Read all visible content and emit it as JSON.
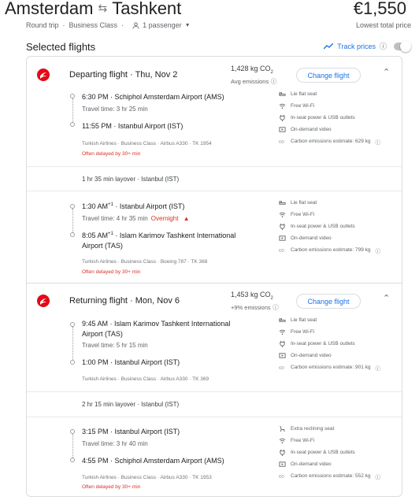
{
  "header": {
    "origin": "Amsterdam",
    "destination": "Tashkent",
    "price": "€1,550",
    "price_note": "Lowest total price",
    "trip_type": "Round trip",
    "cabin": "Business Class",
    "passengers": "1 passenger"
  },
  "selected": {
    "title": "Selected flights",
    "track_prices": "Track prices"
  },
  "departing": {
    "title": "Departing flight · Thu, Nov 2",
    "emissions": "1,428 kg CO",
    "emissions_sub": "2",
    "emissions_note": "Avg emissions",
    "change_label": "Change flight",
    "segments": [
      {
        "dep_time": "6:30 PM",
        "dep_sup": "",
        "dep_airport": "Schiphol Amsterdam Airport (AMS)",
        "travel_time": "Travel time: 3 hr 25 min",
        "overnight": "",
        "arr_time": "11:55 PM",
        "arr_sup": "",
        "arr_airport": "Istanbul Airport (IST)",
        "meta": "Turkish Airlines · Business Class · Airbus A330 · TK 1954",
        "delay": "Often delayed by 30+ min",
        "amenities": [
          "Lie flat seat",
          "Free Wi-Fi",
          "In-seat power & USB outlets",
          "On-demand video",
          "Carbon emissions estimate: 629 kg"
        ]
      },
      {
        "dep_time": "1:30 AM",
        "dep_sup": "+1",
        "dep_airport": "Istanbul Airport (IST)",
        "travel_time": "Travel time: 4 hr 35 min",
        "overnight": "Overnight",
        "arr_time": "8:05 AM",
        "arr_sup": "+1",
        "arr_airport": "Islam Karimov Tashkent International Airport (TAS)",
        "meta": "Turkish Airlines · Business Class · Boeing 787 · TK 368",
        "delay": "Often delayed by 30+ min",
        "amenities": [
          "Lie flat seat",
          "Free Wi-Fi",
          "In-seat power & USB outlets",
          "On-demand video",
          "Carbon emissions estimate: 799 kg"
        ]
      }
    ],
    "layover": "1 hr 35 min layover · Istanbul (IST)"
  },
  "returning": {
    "title": "Returning flight · Mon, Nov 6",
    "emissions": "1,453 kg CO",
    "emissions_sub": "2",
    "emissions_note": "+9% emissions",
    "change_label": "Change flight",
    "segments": [
      {
        "dep_time": "9:45 AM",
        "dep_sup": "",
        "dep_airport": "Islam Karimov Tashkent International Airport (TAS)",
        "travel_time": "Travel time: 5 hr 15 min",
        "overnight": "",
        "arr_time": "1:00 PM",
        "arr_sup": "",
        "arr_airport": "Istanbul Airport (IST)",
        "meta": "Turkish Airlines · Business Class · Airbus A330 · TK 369",
        "delay": "",
        "amenities": [
          "Lie flat seat",
          "Free Wi-Fi",
          "In-seat power & USB outlets",
          "On-demand video",
          "Carbon emissions estimate: 901 kg"
        ]
      },
      {
        "dep_time": "3:15 PM",
        "dep_sup": "",
        "dep_airport": "Istanbul Airport (IST)",
        "travel_time": "Travel time: 3 hr 40 min",
        "overnight": "",
        "arr_time": "4:55 PM",
        "arr_sup": "",
        "arr_airport": "Schiphol Amsterdam Airport (AMS)",
        "meta": "Turkish Airlines · Business Class · Airbus A330 · TK 1953",
        "delay": "Often delayed by 30+ min",
        "amenities": [
          "Extra reclining seat",
          "Free Wi-Fi",
          "In-seat power & USB outlets",
          "On-demand video",
          "Carbon emissions estimate: 552 kg"
        ]
      }
    ],
    "layover": "2 hr 15 min layover · Istanbul (IST)"
  },
  "colors": {
    "accent": "#1a73e8",
    "warning": "#d93025",
    "airline_red": "#e30a17"
  }
}
